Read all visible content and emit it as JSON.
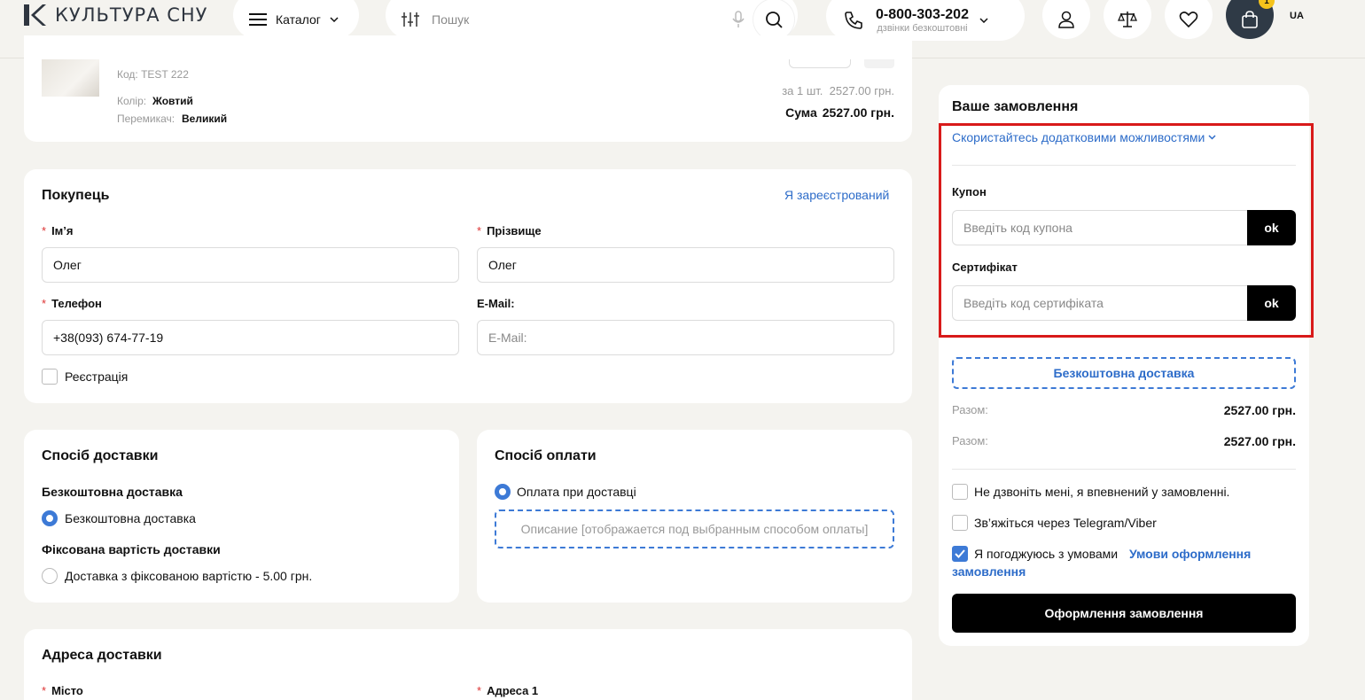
{
  "header": {
    "logo_text": "КУЛЬТУРА СНУ",
    "catalog_label": "Каталог",
    "search_placeholder": "Пошук",
    "phone_number": "0-800-303-202",
    "phone_sub": "дзвінки безкоштовні",
    "cart_count": "1",
    "language": "UA"
  },
  "product": {
    "code": "Код: TEST 222",
    "color_label": "Колір:",
    "color_value": "Жовтий",
    "switch_label": "Перемикач:",
    "switch_value": "Великий",
    "unit_price": "за 1 шт.  2527.00 грн.",
    "sum_label": "Сума",
    "sum_value": "2527.00 грн."
  },
  "buyer": {
    "title": "Покупець",
    "registered_link": "Я зареєстрований",
    "first_name_label": "Ім’я",
    "first_name_value": "Олег",
    "last_name_label": "Прізвище",
    "last_name_value": "Олег",
    "phone_label": "Телефон",
    "phone_value": "+38(093) 674-77-19",
    "email_label": "E-Mail:",
    "email_placeholder": "E-Mail:",
    "register_label": "Реєстрація"
  },
  "delivery": {
    "title": "Спосіб доставки",
    "group1_title": "Безкоштовна доставка",
    "option1": "Безкоштовна доставка",
    "group2_title": "Фіксована вартість доставки",
    "option2": "Доставка з фіксованою вартістю - 5.00 грн."
  },
  "payment": {
    "title": "Спосіб оплати",
    "option1": "Оплата при доставці",
    "description": "Описание [отображается под выбранным способом оплаты]"
  },
  "address": {
    "title": "Адреса доставки",
    "city_label": "Місто",
    "address1_label": "Адреса 1"
  },
  "order": {
    "title": "Ваше замовлення",
    "extra_link": "Скористайтесь додатковими можливостями",
    "coupon_label": "Купон",
    "coupon_placeholder": "Введіть код купона",
    "coupon_btn": "ok",
    "cert_label": "Сертифікат",
    "cert_placeholder": "Введіть код сертифіката",
    "cert_btn": "ok",
    "free_delivery": "Безкоштовна доставка",
    "total1_label": "Разом:",
    "total1_value": "2527.00 грн.",
    "total2_label": "Разом:",
    "total2_value": "2527.00 грн.",
    "check1": "Не дзвоніть мені, я впевнений у замовленні.",
    "check2": "Зв’яжіться через Telegram/Viber",
    "check3_text": "Я погоджуюсь з умовами",
    "check3_link1": "Умови оформлення",
    "check3_link2": "замовлення",
    "submit": "Оформлення замовлення"
  },
  "colors": {
    "accent": "#3d7ad6",
    "highlight": "#d81a1a",
    "dark": "#2f3a46"
  }
}
